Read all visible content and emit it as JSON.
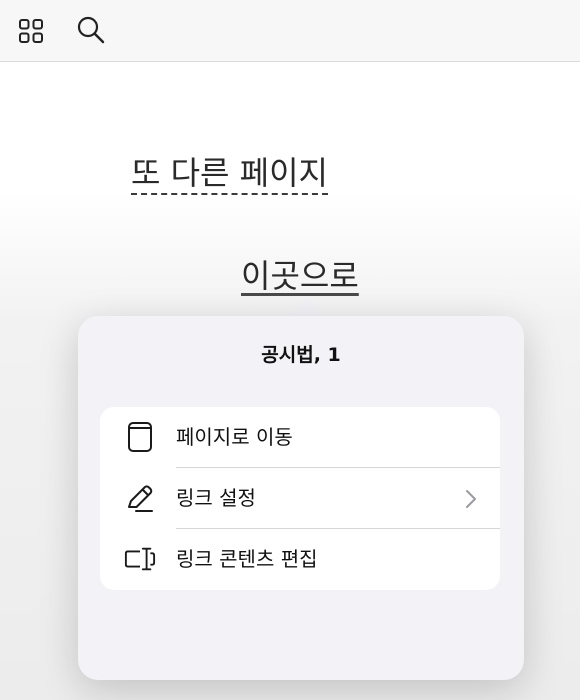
{
  "toolbar": {
    "icons": [
      "grid-icon",
      "search-icon"
    ]
  },
  "document": {
    "link_text_1": "또 다른 페이지",
    "link_text_2": "이곳으로"
  },
  "popover": {
    "title": "공시법, 1",
    "items": [
      {
        "label": "페이지로 이동",
        "icon": "page-icon",
        "has_chevron": false
      },
      {
        "label": "링크 설정",
        "icon": "pencil-icon",
        "has_chevron": true
      },
      {
        "label": "링크 콘텐츠 편집",
        "icon": "text-cursor-icon",
        "has_chevron": false
      }
    ]
  }
}
